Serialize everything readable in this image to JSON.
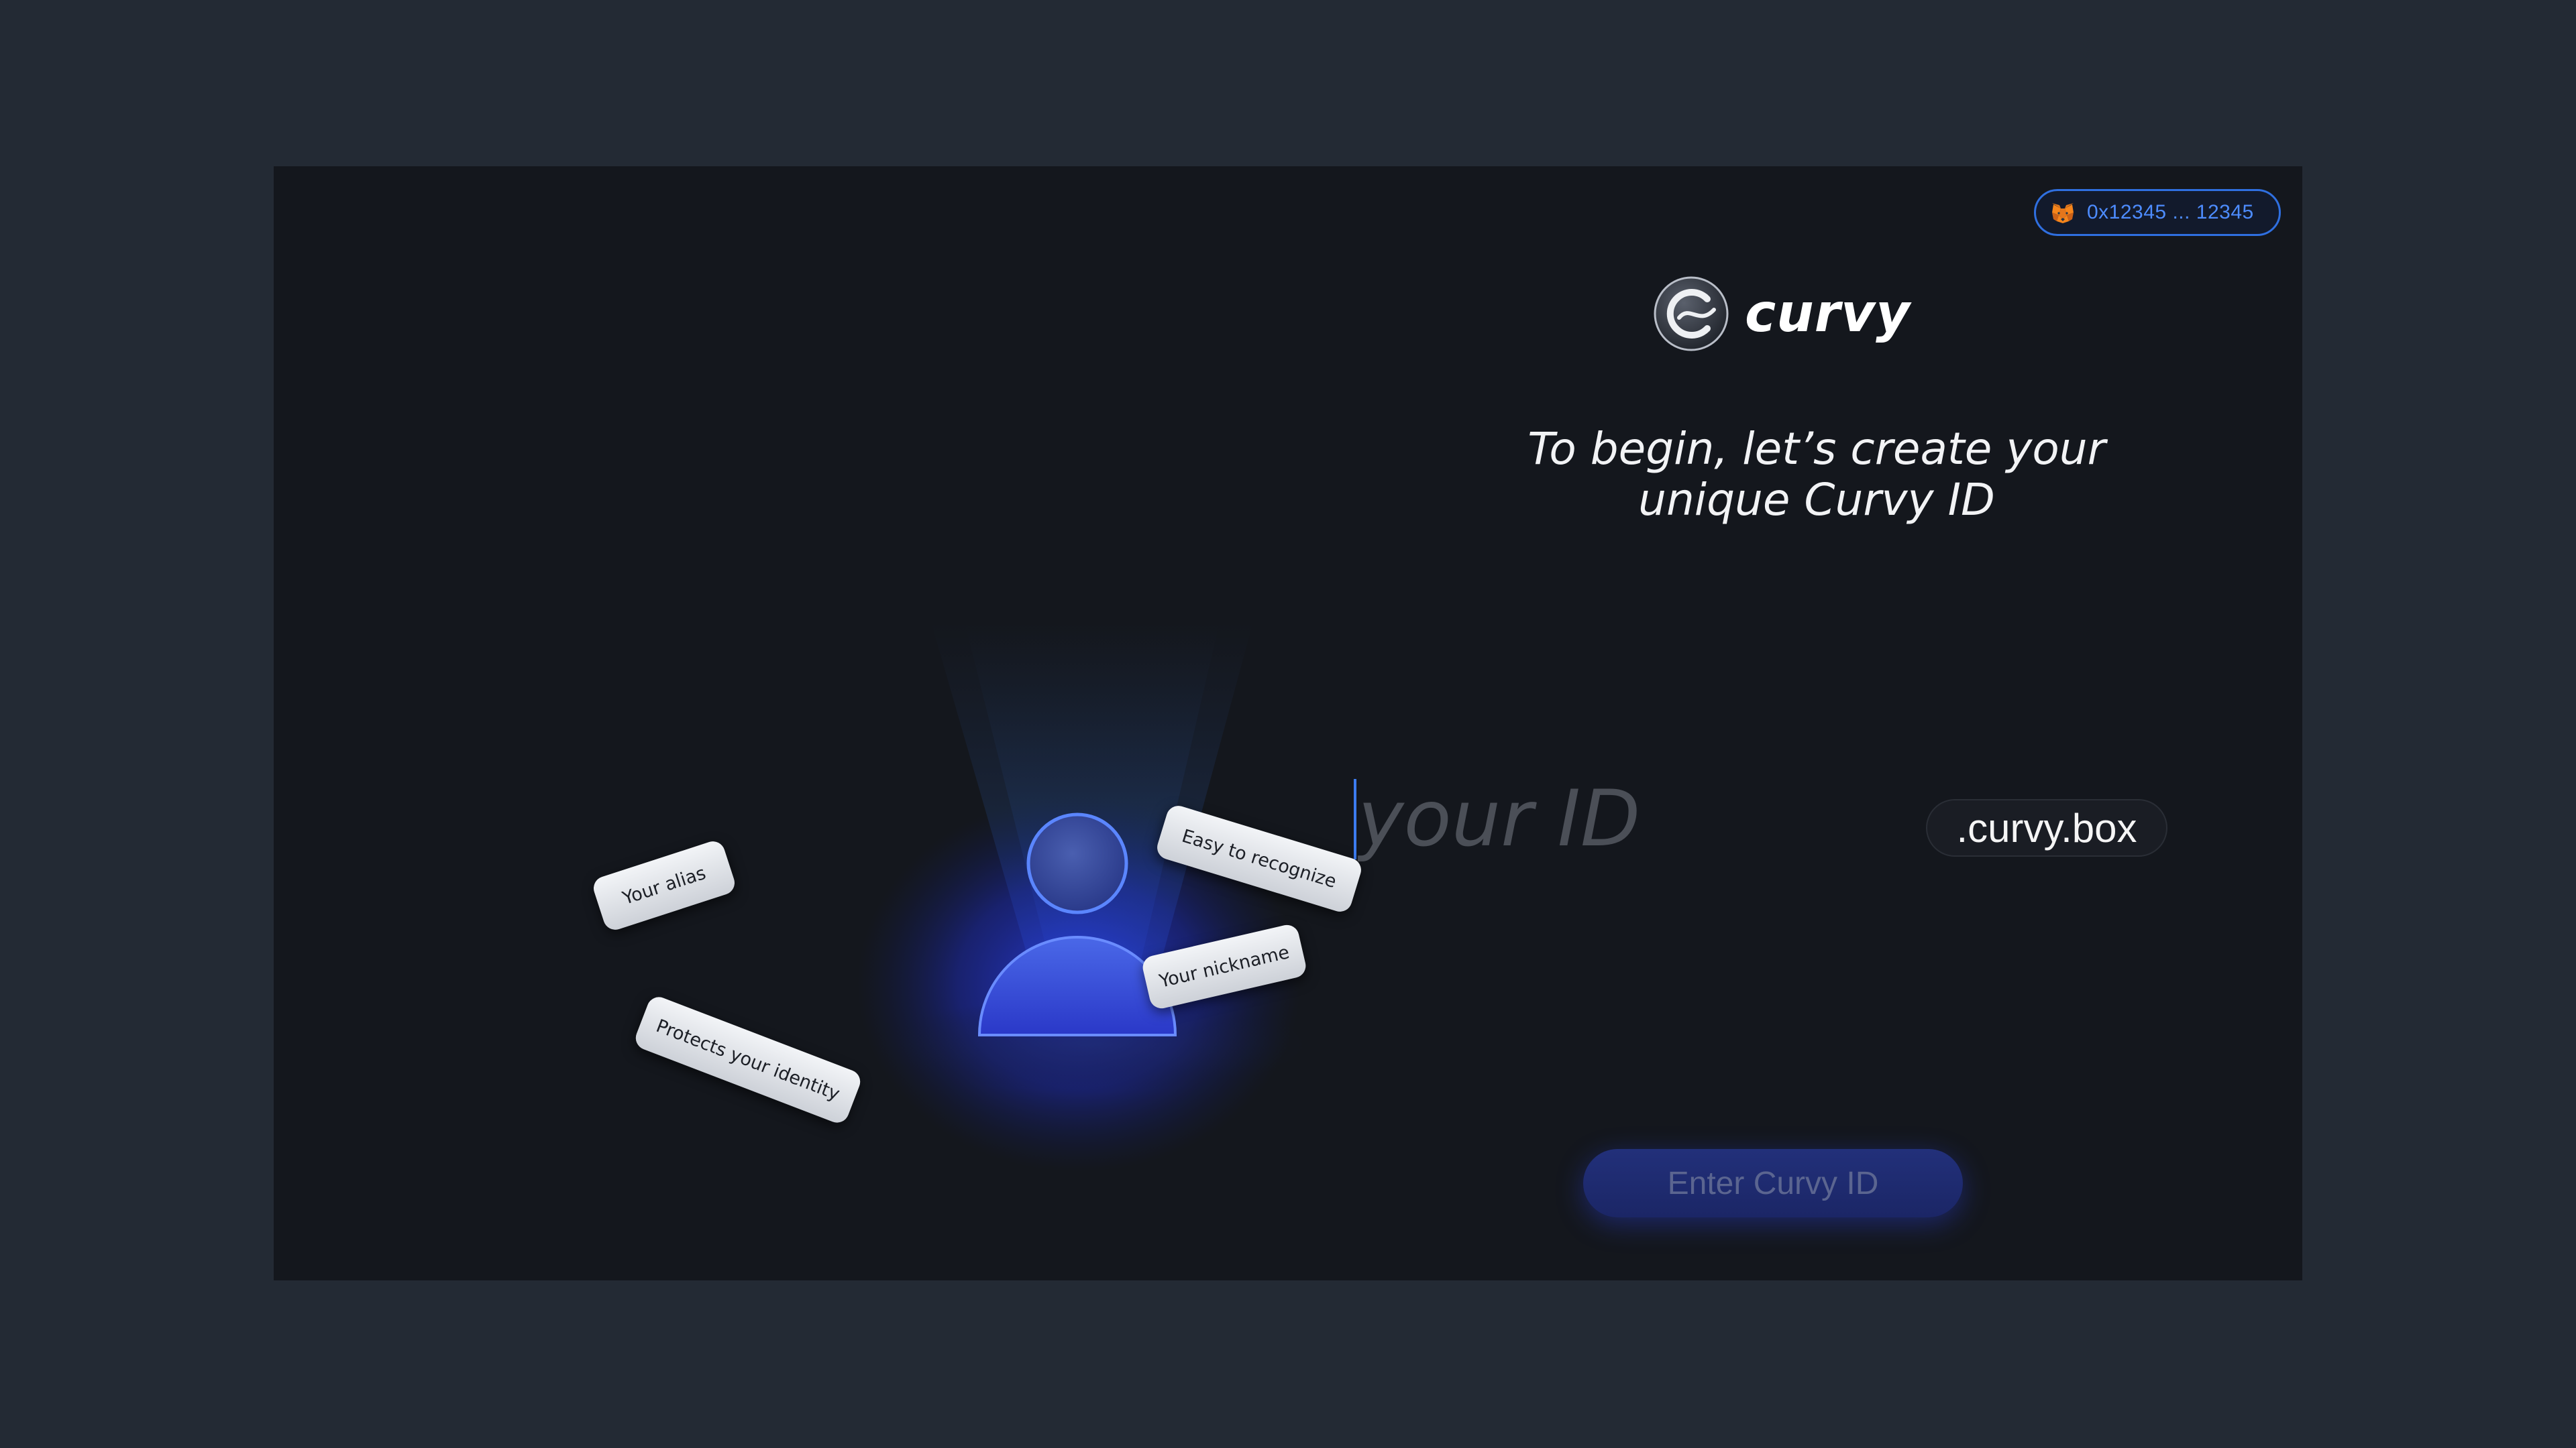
{
  "wallet": {
    "icon": "metamask-fox-icon",
    "address": "0x12345 ... 12345",
    "border_color": "#2f6fe0",
    "text_color": "#4d8cff"
  },
  "brand": {
    "logo_icon": "curvy-logo-icon",
    "name": "curvy"
  },
  "headline": {
    "line1": "To begin, let’s create your",
    "line2": "unique Curvy ID"
  },
  "id_input": {
    "value": "",
    "placeholder": "your ID",
    "suffix": ".curvy.box"
  },
  "submit": {
    "label": "Enter Curvy ID"
  },
  "illustration": {
    "icon": "user-avatar-icon",
    "tags": [
      "Your alias",
      "Easy to recognize",
      "Your nickname",
      "Protects your identity"
    ]
  },
  "colors": {
    "page_background": "#232a34",
    "panel_background": "#14171d",
    "accent_blue": "#2f6fe0",
    "button_fill": "#22307a"
  }
}
